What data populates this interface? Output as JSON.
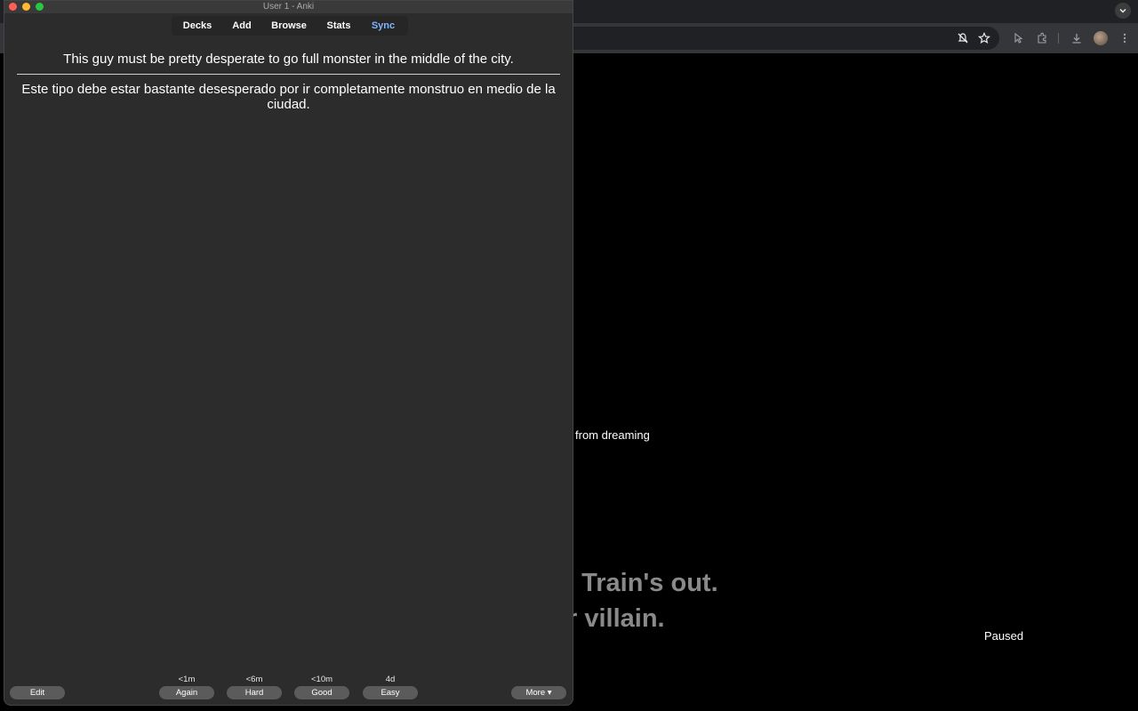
{
  "anki": {
    "window_title": "User 1 - Anki",
    "nav": {
      "decks": "Decks",
      "add": "Add",
      "browse": "Browse",
      "stats": "Stats",
      "sync": "Sync"
    },
    "card": {
      "front": "This guy must be pretty desperate to go full monster in the middle of the city.",
      "back": "Este tipo debe estar bastante desesperado por ir completamente monstruo en medio de la ciudad."
    },
    "bottom_bar": {
      "edit": "Edit",
      "more": "More ▾",
      "answers": [
        {
          "label": "Again",
          "due": "<1m"
        },
        {
          "label": "Hard",
          "due": "<6m"
        },
        {
          "label": "Good",
          "due": "<10m"
        },
        {
          "label": "Easy",
          "due": "4d"
        }
      ]
    }
  },
  "browser": {
    "video": {
      "partial_subtitle": "from dreaming",
      "caption_line1": ". Train's out.",
      "caption_line2": "r villain.",
      "status": "Paused"
    },
    "icons": [
      "chevron-down-icon",
      "mute-icon",
      "star-icon",
      "cursor-icon",
      "extensions-icon",
      "download-icon",
      "avatar",
      "more-vert-icon"
    ]
  },
  "colors": {
    "anki_bg": "#2c2c2c",
    "sync_link": "#7eb6ff",
    "button_bg": "#5b5b5b"
  }
}
